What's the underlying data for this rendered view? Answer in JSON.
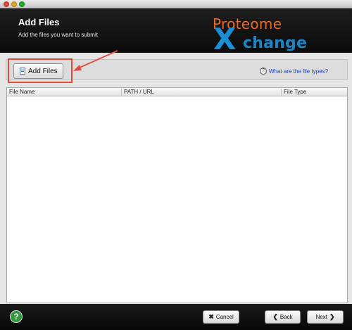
{
  "window": {
    "title": ""
  },
  "header": {
    "title": "Add Files",
    "subtitle": "Add the files you want to submit",
    "logo": {
      "top_word": "Proteome",
      "x_letter": "X",
      "rest_word": "change",
      "top_color": "#e8692b",
      "x_color": "#1c8ed4"
    }
  },
  "toolbar": {
    "add_files_label": "Add Files",
    "help_link_label": "What are the file types?",
    "help_link_icon": "?"
  },
  "table": {
    "columns": [
      "File Name",
      "PATH / URL",
      "File Type"
    ],
    "rows": []
  },
  "annotation": {
    "highlight_color": "#e04c3c"
  },
  "footer": {
    "help_icon": "?",
    "cancel_label": "Cancel",
    "cancel_icon": "✖",
    "back_label": "Back",
    "back_icon": "❮",
    "next_label": "Next",
    "next_icon": "❯"
  }
}
